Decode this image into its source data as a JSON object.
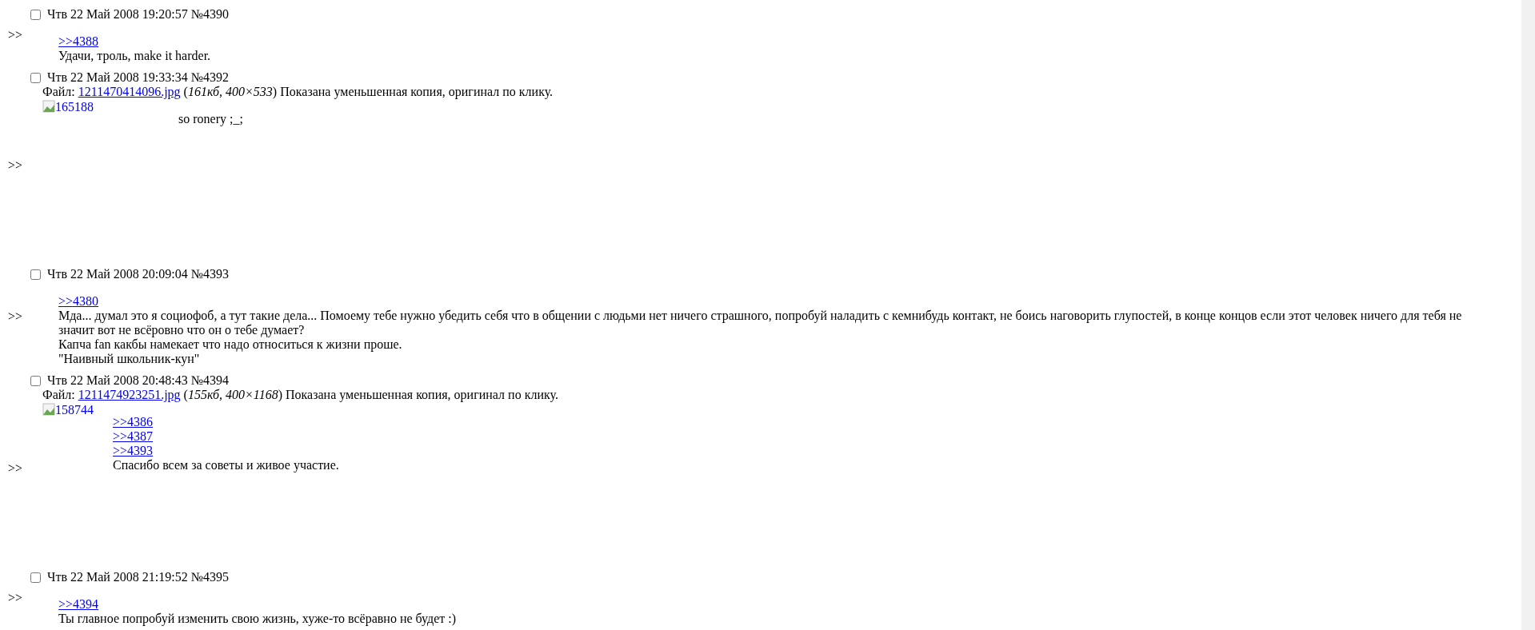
{
  "posts": [
    {
      "marker": ">>",
      "checked": false,
      "header": "Чтв 22 Май 2008 19:20:57 №4390",
      "replies_to": [
        ">>4388"
      ],
      "lines": [
        "Удачи, троль, make it harder."
      ]
    },
    {
      "marker": ">>",
      "checked": false,
      "header": "Чтв 22 Май 2008 19:33:34 №4392",
      "file": {
        "label": "Файл:",
        "name": "1211470414096.jpg",
        "info": "(*161кб, 400×533*) Показана уменьшенная копия, оригинал по клику."
      },
      "thumbnail": {
        "alt": "165188",
        "kind": "portrait"
      },
      "lines": [
        "so ronery ;_;"
      ]
    },
    {
      "marker": ">>",
      "checked": false,
      "header": "Чтв 22 Май 2008 20:09:04 №4393",
      "replies_to": [
        ">>4380"
      ],
      "lines": [
        "Мда... думал это я социофоб, а тут такие дела... Помоему тебе нужно убедить себя что в общении с людьми нет ничего страшного, попробуй наладить с кемнибудь контакт, не боись наговорить глупостей, в конце концов если этот человек ничего для тебя не значит вот не всёровно что он о тебе думает?",
        "Капча fan какбы намекает что надо относиться к жизни проше.",
        "\"Наивный школьник-кун\""
      ]
    },
    {
      "marker": ">>",
      "checked": false,
      "header": "Чтв 22 Май 2008 20:48:43 №4394",
      "file": {
        "label": "Файл:",
        "name": "1211474923251.jpg",
        "info": "(*155кб, 400×1168*) Показана уменьшенная копия, оригинал по клику."
      },
      "thumbnail": {
        "alt": "158744",
        "kind": "tall"
      },
      "replies_to": [
        ">>4386",
        ">>4387",
        ">>4393"
      ],
      "lines": [
        "Спасибо всем за советы и живое участие."
      ]
    },
    {
      "marker": ">>",
      "checked": false,
      "header": "Чтв 22 Май 2008 21:19:52 №4395",
      "replies_to": [
        ">>4394"
      ],
      "lines": [
        "Ты главное попробуй изменить свою жизнь, хуже-то всёравно не будет :)"
      ]
    }
  ]
}
